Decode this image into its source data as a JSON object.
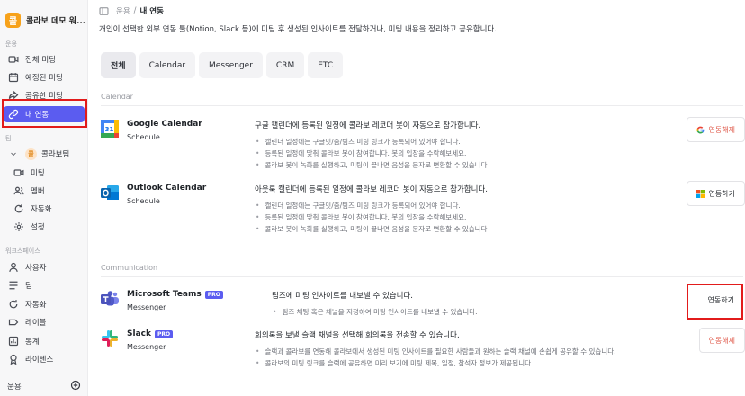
{
  "workspace": {
    "logo": "콜",
    "name": "콜라보 데모 워..."
  },
  "sidebar": {
    "section_usage": "운용",
    "items": [
      {
        "label": "전체 미팅",
        "icon": "video-icon"
      },
      {
        "label": "예정된 미팅",
        "icon": "calendar-icon"
      },
      {
        "label": "공유한 미팅",
        "icon": "share-icon"
      },
      {
        "label": "내 연동",
        "icon": "link-icon"
      }
    ],
    "section_team": "팀",
    "team": {
      "avatar": "콜",
      "name": "콜라보팀"
    },
    "team_items": [
      {
        "label": "미팅",
        "icon": "video-icon"
      },
      {
        "label": "멤버",
        "icon": "users-icon"
      },
      {
        "label": "자동화",
        "icon": "refresh-icon"
      },
      {
        "label": "설정",
        "icon": "gear-icon"
      }
    ],
    "section_workspace": "워크스페이스",
    "workspace_items": [
      {
        "label": "사용자",
        "icon": "user-icon"
      },
      {
        "label": "팀",
        "icon": "team-icon"
      },
      {
        "label": "자동화",
        "icon": "refresh-icon"
      },
      {
        "label": "레이블",
        "icon": "label-icon"
      },
      {
        "label": "통계",
        "icon": "stats-icon"
      },
      {
        "label": "라이센스",
        "icon": "license-icon"
      }
    ],
    "bottom": {
      "label": "운용",
      "icon": "add-circle-icon"
    }
  },
  "breadcrumb": {
    "parent": "운용",
    "separator": "/",
    "current": "내 연동"
  },
  "description": "개인이 선택한 외부 연동 툴(Notion, Slack 등)에 미팅 후 생성된 인사이트를 전달하거나, 미팅 내용을 정리하고 공유합니다.",
  "tabs": [
    "전체",
    "Calendar",
    "Messenger",
    "CRM",
    "ETC"
  ],
  "categories": {
    "calendar": "Calendar",
    "communication": "Communication"
  },
  "integrations": {
    "google": {
      "name": "Google Calendar",
      "type": "Schedule",
      "title": "구글 캘린더에 등록된 일정에 콜라보 레코더 봇이 자동으로 참가합니다.",
      "bullets": [
        "캘린더 일정에는 구글밋/줌/팀즈 미팅 링크가 등록되어 있어야 합니다.",
        "등록된 일정에 맞춰 콜라보 봇이 참여합니다. 봇의 입장을 수락해보세요.",
        "콜라보 봇이 녹화를 실행하고, 미팅이 끝나면 음성을 문자로 변환할 수 있습니다"
      ],
      "button": "연동해제"
    },
    "outlook": {
      "name": "Outlook Calendar",
      "type": "Schedule",
      "title": "아웃룩 캘린더에 등록된 일정에 콜라보 레코더 봇이 자동으로 참가합니다.",
      "bullets": [
        "캘린더 일정에는 구글밋/줌/팀즈 미팅 링크가 등록되어 있어야 합니다.",
        "등록된 일정에 맞춰 콜라보 봇이 참여합니다. 봇의 입장을 수락해보세요.",
        "콜라보 봇이 녹화를 실행하고, 미팅이 끝나면 음성을 문자로 변환할 수 있습니다"
      ],
      "button": "연동하기"
    },
    "teams": {
      "name": "Microsoft Teams",
      "badge": "PRO",
      "type": "Messenger",
      "title": "팀즈에 미팅 인사이트를 내보낼 수 있습니다.",
      "bullets": [
        "팀즈 채팅 혹은 채널을 지정하여 미팅 인사이트를 내보낼 수 있습니다."
      ],
      "button": "연동하기"
    },
    "slack": {
      "name": "Slack",
      "badge": "PRO",
      "type": "Messenger",
      "title": "회의록을 보낼 슬랙 채널을 선택해 회의록을 전송할 수 있습니다.",
      "bullets": [
        "슬랙과 콜라보를 연동해 콜라보에서 생성된 미팅 인사이트를 필요한 사람들과 원하는 슬랙 채널에 손쉽게 공유할 수 있습니다.",
        "콜라보의 미팅 링크를 슬랙에 공유하면 미리 보기에 미팅 제목, 일정, 참석자 정보가 제공됩니다."
      ],
      "button": "연동해제"
    }
  },
  "colors": {
    "accent": "#5b5cf0",
    "highlight": "#e21b1b",
    "disconnect": "#e05c4d"
  }
}
